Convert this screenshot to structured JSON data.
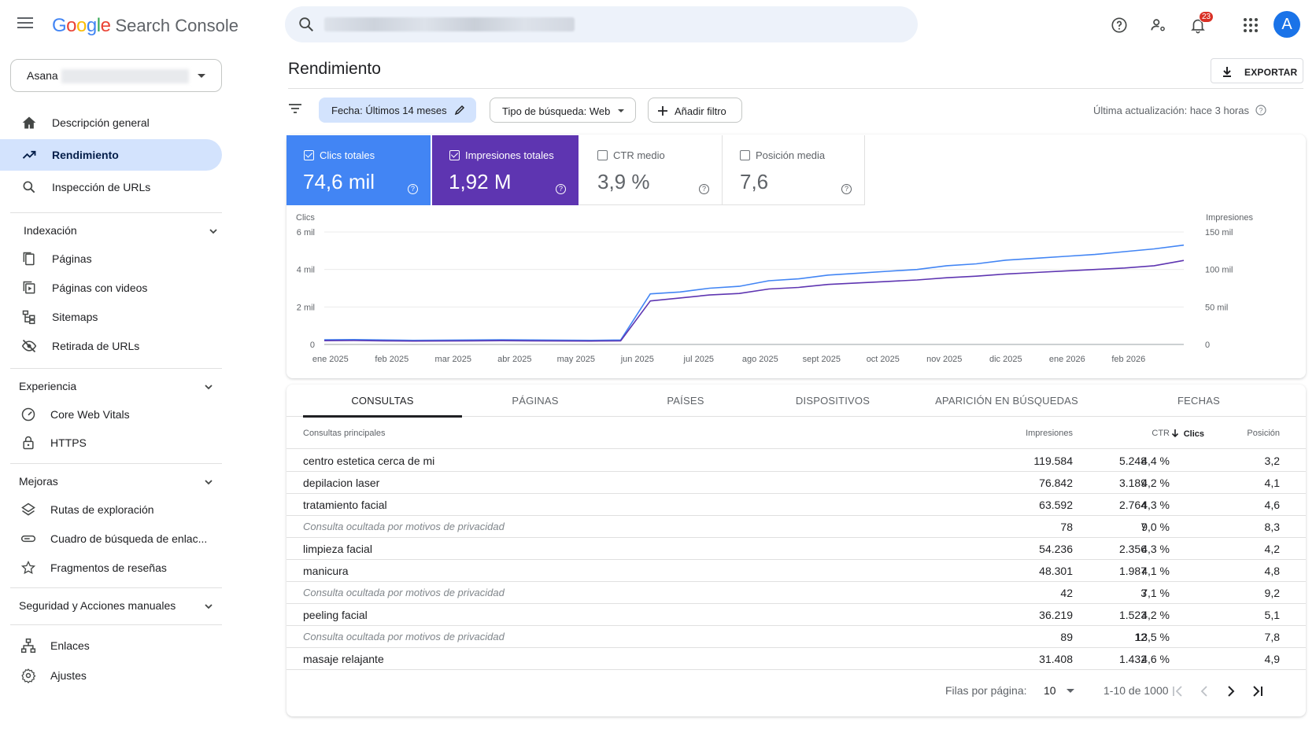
{
  "header": {
    "logo_google": [
      "G",
      "o",
      "o",
      "g",
      "l",
      "e"
    ],
    "logo_product": "Search Console",
    "notifications_count": "23",
    "avatar_letter": "A"
  },
  "sidebar": {
    "property_name": "Asana",
    "items": [
      {
        "label": "Descripción general",
        "icon": "home-icon"
      },
      {
        "label": "Rendimiento",
        "icon": "trending-icon",
        "active": true
      },
      {
        "label": "Inspección de URLs",
        "icon": "search-icon"
      }
    ],
    "sections": [
      {
        "title": "Indexación",
        "items": [
          {
            "label": "Páginas",
            "icon": "pages-icon"
          },
          {
            "label": "Páginas con videos",
            "icon": "video-pages-icon"
          },
          {
            "label": "Sitemaps",
            "icon": "sitemap-icon"
          },
          {
            "label": "Retirada de URLs",
            "icon": "eye-off-icon"
          }
        ]
      },
      {
        "title": "Experiencia",
        "items": [
          {
            "label": "Core Web Vitals",
            "icon": "gauge-icon"
          },
          {
            "label": "HTTPS",
            "icon": "lock-icon"
          }
        ]
      },
      {
        "title": "Mejoras",
        "items": [
          {
            "label": "Rutas de exploración",
            "icon": "layers-icon"
          },
          {
            "label": "Cuadro de búsqueda de enlac...",
            "icon": "searchbox-icon"
          },
          {
            "label": "Fragmentos de reseñas",
            "icon": "star-icon"
          }
        ]
      },
      {
        "title": "Seguridad y Acciones manuales",
        "items": []
      }
    ],
    "bottom_items": [
      {
        "label": "Enlaces",
        "icon": "links-icon"
      },
      {
        "label": "Ajustes",
        "icon": "gear-icon"
      }
    ]
  },
  "main": {
    "title": "Rendimiento",
    "export_label": "EXPORTAR",
    "filters": {
      "date": "Fecha: Últimos 14 meses",
      "search_type": "Tipo de búsqueda: Web",
      "add": "Añadir filtro"
    },
    "last_update": "Última actualización: hace 3 horas"
  },
  "metrics": {
    "clicks": {
      "label": "Clics totales",
      "value": "74,6 mil",
      "checked": true,
      "color": "#4285f4"
    },
    "impressions": {
      "label": "Impresiones totales",
      "value": "1,92 M",
      "checked": true,
      "color": "#5e35b1"
    },
    "ctr": {
      "label": "CTR medio",
      "value": "3,9 %",
      "checked": false
    },
    "position": {
      "label": "Posición media",
      "value": "7,6",
      "checked": false
    }
  },
  "chart_data": {
    "type": "line",
    "ylabel_left": "Clics",
    "ylabel_right": "Impresiones",
    "yticks_left": [
      "0",
      "2 mil",
      "4 mil",
      "6 mil"
    ],
    "yticks_right": [
      "0",
      "50 mil",
      "100 mil",
      "150 mil"
    ],
    "ylim_left": [
      0,
      6000
    ],
    "ylim_right": [
      0,
      150000
    ],
    "x_ticks": [
      "ene 2025",
      "feb 2025",
      "mar 2025",
      "abr 2025",
      "may 2025",
      "jun 2025",
      "jul 2025",
      "ago 2025",
      "sept 2025",
      "oct 2025",
      "nov 2025",
      "dic 2025",
      "ene 2026",
      "feb 2026"
    ],
    "grid": true,
    "series": [
      {
        "name": "Clics",
        "axis": "left",
        "color": "#4285f4",
        "values": [
          250,
          260,
          240,
          220,
          230,
          240,
          250,
          240,
          230,
          220,
          240,
          2700,
          2800,
          3000,
          3100,
          3400,
          3500,
          3700,
          3800,
          3900,
          4000,
          4200,
          4300,
          4500,
          4600,
          4700,
          4800,
          4950,
          5100,
          5300
        ]
      },
      {
        "name": "Impresiones",
        "axis": "right",
        "color": "#5e35b1",
        "values": [
          5000,
          5200,
          4800,
          4500,
          4600,
          4800,
          5000,
          4800,
          4600,
          4500,
          4800,
          58000,
          62000,
          66000,
          68000,
          74000,
          76000,
          80000,
          82000,
          84000,
          86000,
          89000,
          91000,
          94000,
          96000,
          98000,
          100000,
          102000,
          105000,
          112000
        ]
      }
    ]
  },
  "table": {
    "tabs": [
      "CONSULTAS",
      "PÁGINAS",
      "PAÍSES",
      "DISPOSITIVOS",
      "APARICIÓN EN BÚSQUEDAS",
      "FECHAS"
    ],
    "headers": {
      "query": "Consultas principales",
      "clicks": "Clics",
      "impressions": "Impresiones",
      "ctr": "CTR",
      "position": "Posición"
    },
    "rows": [
      {
        "q": "centro estetica cerca de mi",
        "c": "5.248",
        "i": "119.584",
        "ctr": "4,4 %",
        "p": "3,2",
        "priv": false
      },
      {
        "q": "depilacion laser",
        "c": "3.189",
        "i": "76.842",
        "ctr": "4,2 %",
        "p": "4,1",
        "priv": false
      },
      {
        "q": "tratamiento facial",
        "c": "2.764",
        "i": "63.592",
        "ctr": "4,3 %",
        "p": "4,6",
        "priv": false
      },
      {
        "q": "Consulta ocultada por motivos de privacidad",
        "c": "7",
        "i": "78",
        "ctr": "9,0 %",
        "p": "8,3",
        "priv": true
      },
      {
        "q": "limpieza facial",
        "c": "2.356",
        "i": "54.236",
        "ctr": "4,3 %",
        "p": "4,2",
        "priv": false
      },
      {
        "q": "manicura",
        "c": "1.987",
        "i": "48.301",
        "ctr": "4,1 %",
        "p": "4,8",
        "priv": false
      },
      {
        "q": "Consulta ocultada por motivos de privacidad",
        "c": "3",
        "i": "42",
        "ctr": "7,1 %",
        "p": "9,2",
        "priv": true
      },
      {
        "q": "peeling facial",
        "c": "1.523",
        "i": "36.219",
        "ctr": "4,2 %",
        "p": "5,1",
        "priv": false
      },
      {
        "q": "Consulta ocultada por motivos de privacidad",
        "c": "12",
        "i": "89",
        "ctr": "13,5 %",
        "p": "7,8",
        "priv": true
      },
      {
        "q": "masaje relajante",
        "c": "1.432",
        "i": "31.408",
        "ctr": "4,6 %",
        "p": "4,9",
        "priv": false
      }
    ],
    "pager": {
      "rows_label": "Filas por página:",
      "rows_value": "10",
      "range": "1-10 de 1000"
    }
  }
}
